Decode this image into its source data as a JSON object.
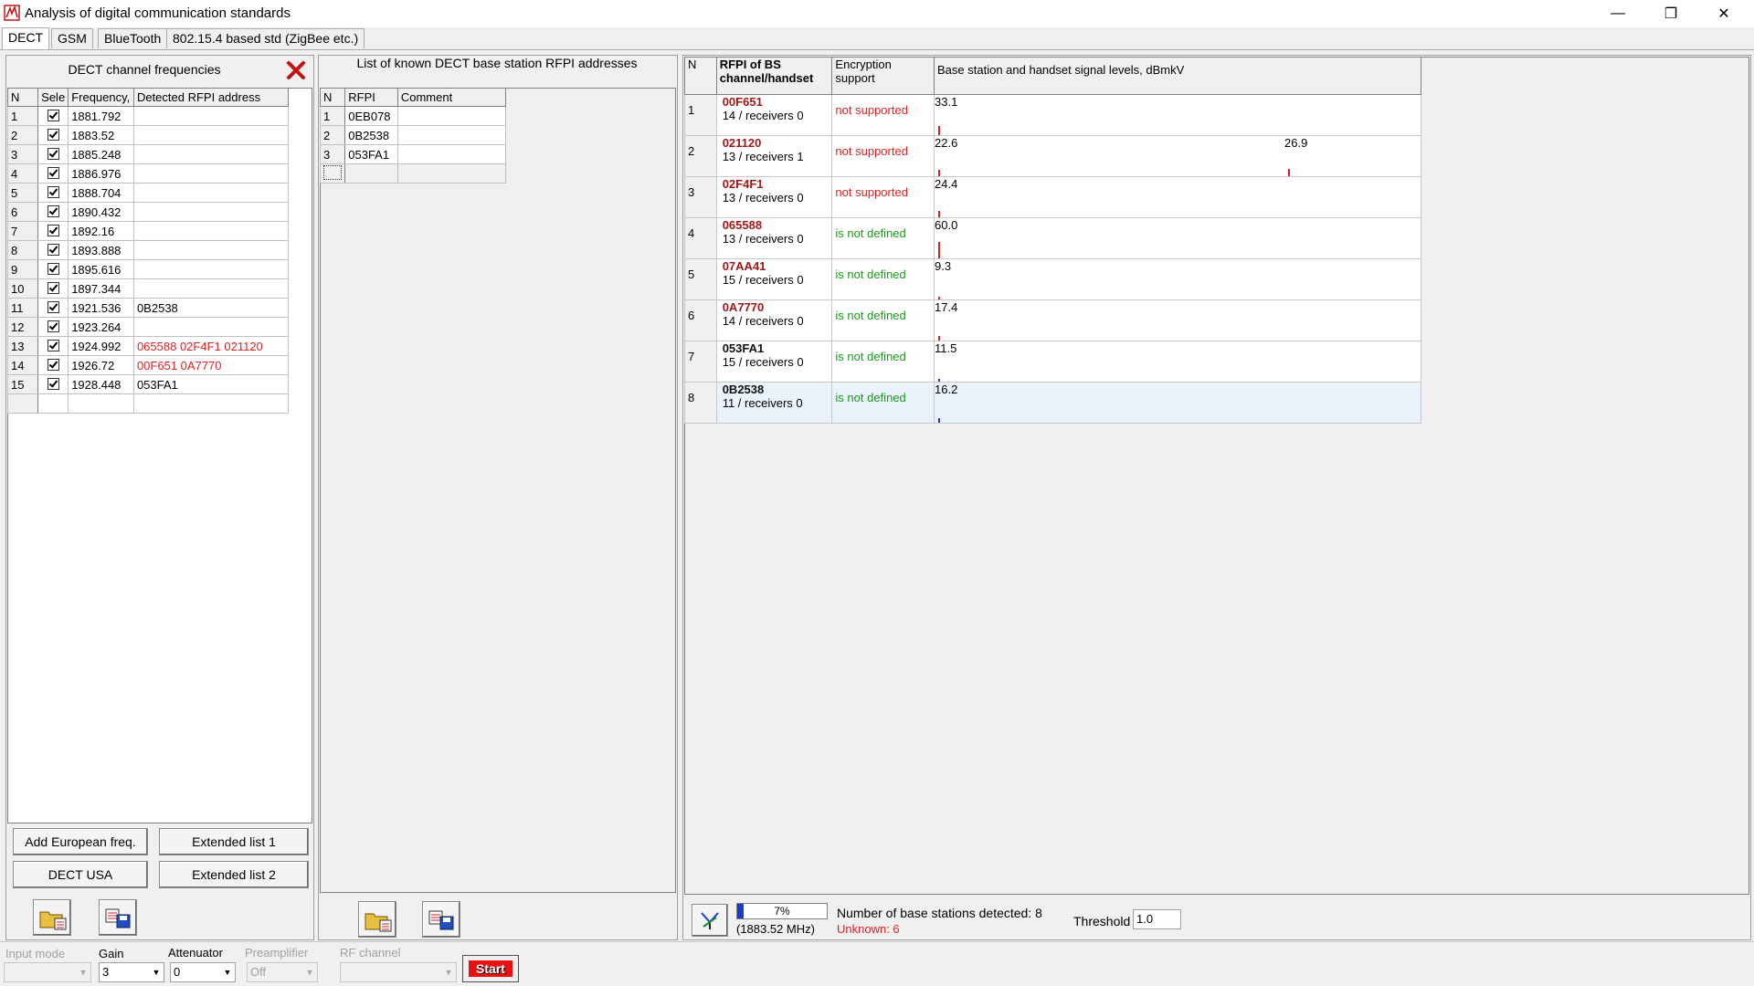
{
  "window": {
    "title": "Analysis of digital communication standards",
    "minimize": "—",
    "restore": "❐",
    "close": "✕"
  },
  "tabs": [
    "DECT",
    "GSM",
    "BlueTooth",
    "802.15.4 based std (ZigBee etc.)"
  ],
  "channels": {
    "title": "DECT channel frequencies",
    "headers": [
      "N",
      "Sele",
      "Frequency,",
      "Detected RFPI address"
    ],
    "rows": [
      {
        "n": "1",
        "freq": "1881.792",
        "rfpi": "",
        "red": false
      },
      {
        "n": "2",
        "freq": "1883.52",
        "rfpi": "",
        "red": false
      },
      {
        "n": "3",
        "freq": "1885.248",
        "rfpi": "",
        "red": false
      },
      {
        "n": "4",
        "freq": "1886.976",
        "rfpi": "",
        "red": false
      },
      {
        "n": "5",
        "freq": "1888.704",
        "rfpi": "",
        "red": false
      },
      {
        "n": "6",
        "freq": "1890.432",
        "rfpi": "",
        "red": false
      },
      {
        "n": "7",
        "freq": "1892.16",
        "rfpi": "",
        "red": false
      },
      {
        "n": "8",
        "freq": "1893.888",
        "rfpi": "",
        "red": false
      },
      {
        "n": "9",
        "freq": "1895.616",
        "rfpi": "",
        "red": false
      },
      {
        "n": "10",
        "freq": "1897.344",
        "rfpi": "",
        "red": false
      },
      {
        "n": "11",
        "freq": "1921.536",
        "rfpi": "0B2538",
        "red": false
      },
      {
        "n": "12",
        "freq": "1923.264",
        "rfpi": "",
        "red": false
      },
      {
        "n": "13",
        "freq": "1924.992",
        "rfpi": "065588 02F4F1 021120",
        "red": true
      },
      {
        "n": "14",
        "freq": "1926.72",
        "rfpi": "00F651 0A7770",
        "red": true
      },
      {
        "n": "15",
        "freq": "1928.448",
        "rfpi": "053FA1",
        "red": false
      }
    ],
    "btn_add_european": "Add European freq.",
    "btn_extended1": "Extended list 1",
    "btn_dect_usa": "DECT USA",
    "btn_extended2": "Extended list 2"
  },
  "known": {
    "title": "List of known DECT base station RFPI addresses",
    "headers": [
      "N",
      "RFPI",
      "Comment"
    ],
    "rows": [
      {
        "n": "1",
        "rfpi": "0EB078",
        "comment": ""
      },
      {
        "n": "2",
        "rfpi": "0B2538",
        "comment": ""
      },
      {
        "n": "3",
        "rfpi": "053FA1",
        "comment": ""
      }
    ]
  },
  "stations": {
    "headers": {
      "n": "N",
      "rfpi_line1": "RFPI of BS",
      "rfpi_line2": "channel/handset",
      "enc_line1": "Encryption",
      "enc_line2": "support",
      "levels": "Base station and handset signal levels, dBmkV"
    },
    "level_max": 100,
    "rows": [
      {
        "n": "1",
        "rfpi": "00F651",
        "sub": "14 / receivers 0",
        "enc": "not supported",
        "enc_type": "ns",
        "rfpi_color": "red",
        "levels": [
          {
            "value": 33.1,
            "label": "33.1",
            "pos": 0,
            "color": "#e02020"
          }
        ]
      },
      {
        "n": "2",
        "rfpi": "021120",
        "sub": "13 / receivers 1",
        "enc": "not supported",
        "enc_type": "ns",
        "rfpi_color": "red",
        "levels": [
          {
            "value": 22.6,
            "label": "22.6",
            "pos": 0,
            "color": "#e02020"
          },
          {
            "value": 26.9,
            "label": "26.9",
            "pos": 0.722,
            "color": "#e02020"
          }
        ]
      },
      {
        "n": "3",
        "rfpi": "02F4F1",
        "sub": "13 / receivers 0",
        "enc": "not supported",
        "enc_type": "ns",
        "rfpi_color": "red",
        "levels": [
          {
            "value": 24.4,
            "label": "24.4",
            "pos": 0,
            "color": "#e02020"
          }
        ]
      },
      {
        "n": "4",
        "rfpi": "065588",
        "sub": "13 / receivers 0",
        "enc": "is not defined",
        "enc_type": "nd",
        "rfpi_color": "red",
        "levels": [
          {
            "value": 60.0,
            "label": "60.0",
            "pos": 0,
            "color": "#e02020"
          }
        ]
      },
      {
        "n": "5",
        "rfpi": "07AA41",
        "sub": "15 / receivers 0",
        "enc": "is not defined",
        "enc_type": "nd",
        "rfpi_color": "red",
        "levels": [
          {
            "value": 9.3,
            "label": "9.3",
            "pos": 0,
            "color": "#e02020"
          }
        ]
      },
      {
        "n": "6",
        "rfpi": "0A7770",
        "sub": "14 / receivers 0",
        "enc": "is not defined",
        "enc_type": "nd",
        "rfpi_color": "red",
        "levels": [
          {
            "value": 17.4,
            "label": "17.4",
            "pos": 0,
            "color": "#e02020"
          }
        ]
      },
      {
        "n": "7",
        "rfpi": "053FA1",
        "sub": "15 / receivers 0",
        "enc": "is not defined",
        "enc_type": "nd",
        "rfpi_color": "black",
        "levels": [
          {
            "value": 11.5,
            "label": "11.5",
            "pos": 0,
            "color": "#1a3ad0"
          }
        ]
      },
      {
        "n": "8",
        "rfpi": "0B2538",
        "sub": "11 / receivers 0",
        "enc": "is not defined",
        "enc_type": "nd",
        "rfpi_color": "black",
        "levels": [
          {
            "value": 16.2,
            "label": "16.2",
            "pos": 0,
            "color": "#1a3ad0"
          }
        ]
      }
    ]
  },
  "status": {
    "progress_label": "7%",
    "progress_value": 0.07,
    "freq": "(1883.52 MHz)",
    "detected": "Number of base stations detected: 8",
    "unknown": "Unknown: 6",
    "threshold_label": "Threshold",
    "threshold_value": "1.0"
  },
  "controls": {
    "input_mode_label": "Input mode",
    "input_mode_value": "",
    "gain_label": "Gain",
    "gain_value": "3",
    "attenuator_label": "Attenuator",
    "attenuator_value": "0",
    "preamp_label": "Preamplifier",
    "preamp_value": "Off",
    "rf_channel_label": "RF channel",
    "rf_channel_value": "",
    "start": "Start"
  }
}
